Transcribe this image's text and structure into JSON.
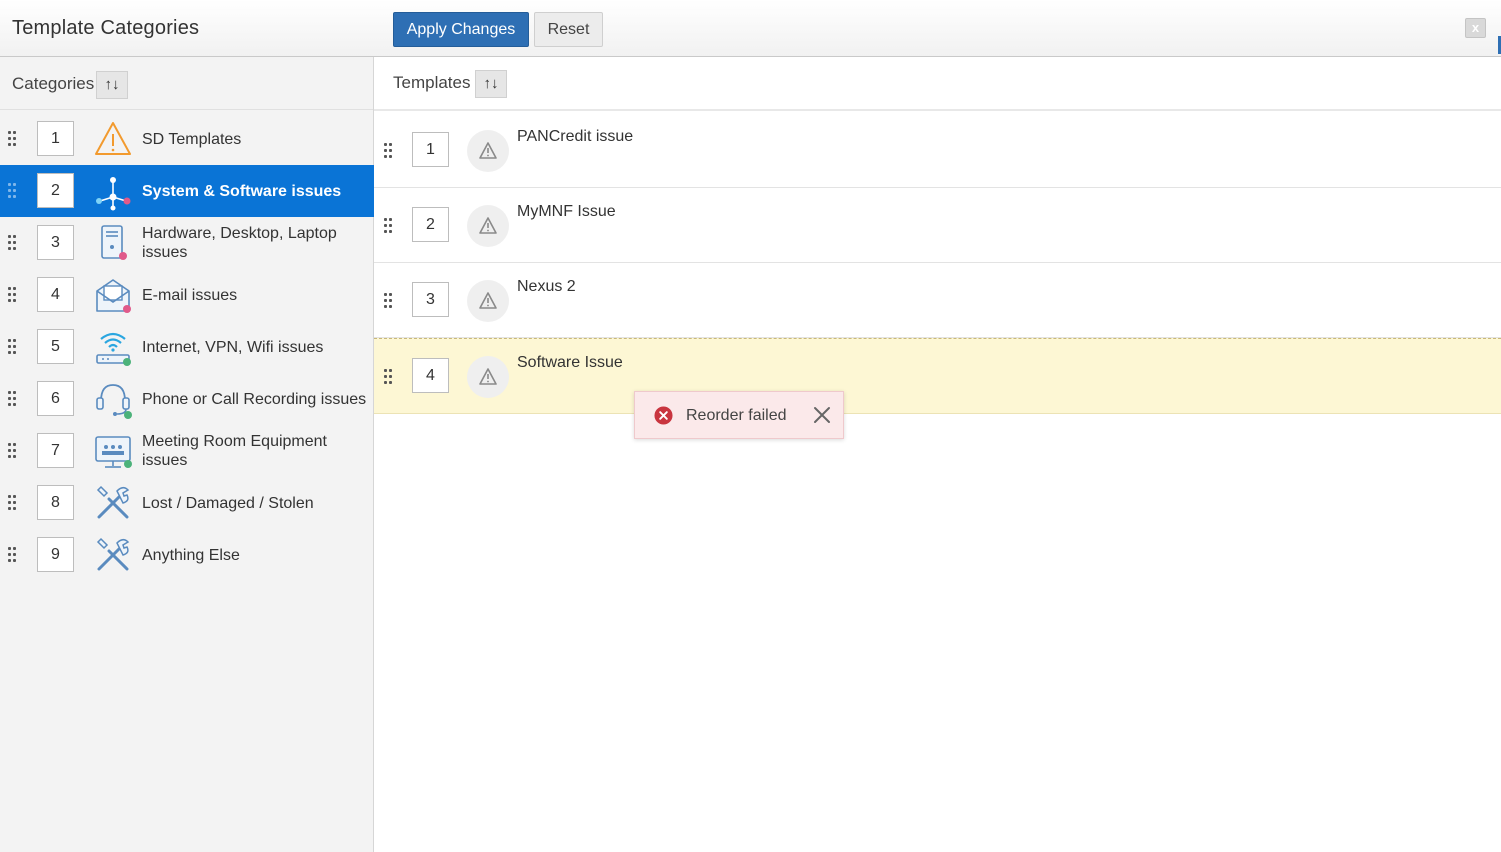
{
  "header": {
    "title": "Template Categories",
    "apply_label": "Apply Changes",
    "reset_label": "Reset",
    "close_label": "x"
  },
  "categories_panel": {
    "heading": "Categories",
    "sort_label": "↑↓",
    "selected_index": 1,
    "items": [
      {
        "order": "1",
        "label": "SD Templates",
        "icon": "warning-triangle-icon"
      },
      {
        "order": "2",
        "label": "System & Software issues",
        "icon": "network-nodes-icon"
      },
      {
        "order": "3",
        "label": "Hardware, Desktop, Laptop issues",
        "icon": "desktop-tower-icon"
      },
      {
        "order": "4",
        "label": "E-mail issues",
        "icon": "envelope-icon"
      },
      {
        "order": "5",
        "label": "Internet, VPN, Wifi issues",
        "icon": "wifi-router-icon"
      },
      {
        "order": "6",
        "label": "Phone or Call Recording issues",
        "icon": "phone-headset-icon"
      },
      {
        "order": "7",
        "label": "Meeting Room Equipment issues",
        "icon": "meeting-room-icon"
      },
      {
        "order": "8",
        "label": "Lost / Damaged / Stolen",
        "icon": "tools-icon"
      },
      {
        "order": "9",
        "label": "Anything Else",
        "icon": "tools-icon"
      }
    ]
  },
  "templates_panel": {
    "heading": "Templates",
    "sort_label": "↑↓",
    "items": [
      {
        "order": "1",
        "label": "PANCredit issue",
        "icon": "alert-triangle-icon"
      },
      {
        "order": "2",
        "label": "MyMNF Issue",
        "icon": "alert-triangle-icon"
      },
      {
        "order": "3",
        "label": "Nexus 2",
        "icon": "alert-triangle-icon"
      },
      {
        "order": "4",
        "label": "Software Issue",
        "icon": "alert-triangle-icon",
        "highlighted": true
      }
    ]
  },
  "toast": {
    "message": "Reorder failed",
    "icon": "error-circle-icon",
    "close_icon": "close-icon"
  },
  "colors": {
    "accent": "#0a74d6",
    "apply_button": "#2e6fb4",
    "highlight_row": "#fdf7d4",
    "toast_bg": "#fbe9ea",
    "error_red": "#c9353f"
  }
}
